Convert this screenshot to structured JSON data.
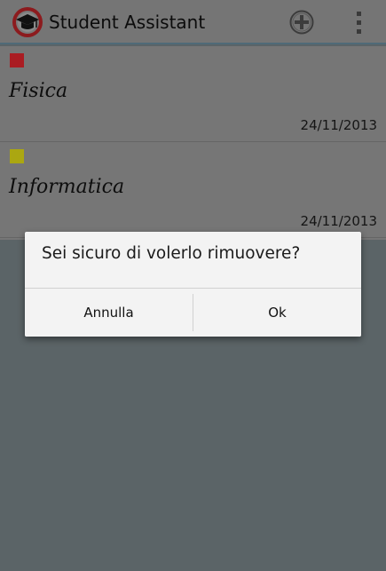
{
  "app": {
    "title": "Student Assistant",
    "logo_icon": "graduation-cap-icon",
    "add_icon": "add-circle-icon",
    "menu_icon": "overflow-menu-icon"
  },
  "subjects": [
    {
      "name": "Fisica",
      "date": "24/11/2013",
      "color": "#b40d14"
    },
    {
      "name": "Informatica",
      "date": "24/11/2013",
      "color": "#b5b000"
    }
  ],
  "dialog": {
    "message": "Sei sicuro di volerlo rimuovere?",
    "cancel_label": "Annulla",
    "ok_label": "Ok"
  }
}
